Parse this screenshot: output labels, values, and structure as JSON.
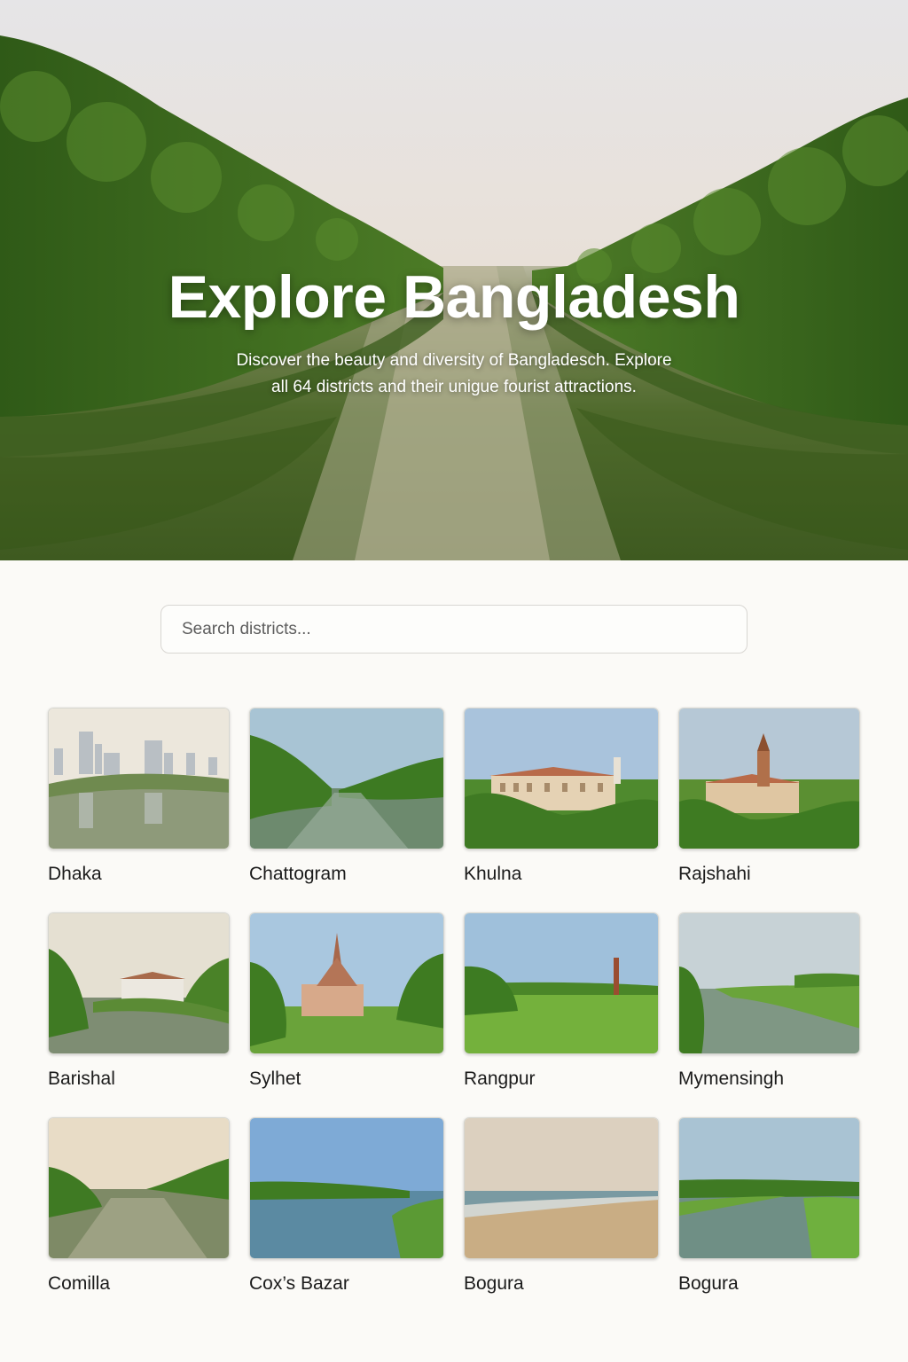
{
  "hero": {
    "title": "Explore Bangladesh",
    "subtitle": "Discover the beauty and diversity of Bangladesch. Explore all 64 districts and their unigue fourist attractions."
  },
  "search": {
    "placeholder": "Search districts..."
  },
  "districts": [
    {
      "name": "Dhaka"
    },
    {
      "name": "Chattogram"
    },
    {
      "name": "Khulna"
    },
    {
      "name": "Rajshahi"
    },
    {
      "name": "Barishal"
    },
    {
      "name": "Sylhet"
    },
    {
      "name": "Rangpur"
    },
    {
      "name": "Mymensingh"
    },
    {
      "name": "Comilla"
    },
    {
      "name": "Cox’s Bazar"
    },
    {
      "name": "Bogura"
    },
    {
      "name": "Bogura"
    }
  ]
}
